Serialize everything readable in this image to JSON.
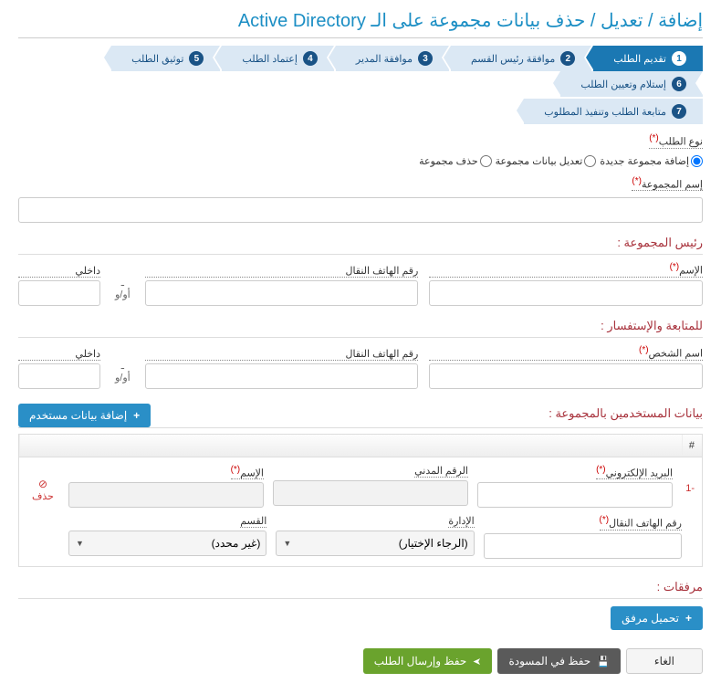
{
  "title": "إضافة / تعديل / حذف بيانات مجموعة على الـ Active Directory",
  "steps": [
    {
      "n": "1",
      "label": "تقديم الطلب",
      "active": true
    },
    {
      "n": "2",
      "label": "موافقة رئيس القسم"
    },
    {
      "n": "3",
      "label": "موافقة المدير"
    },
    {
      "n": "4",
      "label": "إعتماد الطلب"
    },
    {
      "n": "5",
      "label": "توثيق الطلب"
    },
    {
      "n": "6",
      "label": "إستلام وتعيين الطلب"
    }
  ],
  "step7": {
    "n": "7",
    "label": "متابعة الطلب وتنفيذ المطلوب"
  },
  "reqType": {
    "label": "نوع الطلب",
    "opts": [
      "إضافة مجموعة جديدة",
      "تعديل بيانات مجموعة",
      "حذف مجموعة"
    ]
  },
  "groupName": {
    "label": "إسم المجموعة"
  },
  "head": {
    "title": "رئيس المجموعة :",
    "name": "الإسم",
    "mobile": "رقم الهاتف النقال",
    "sep1": "ـ",
    "sep2": "أو/و",
    "ext": "داخلي"
  },
  "follow": {
    "title": "للمتابعة والإستفسار :",
    "name": "اسم الشخص",
    "mobile": "رقم الهاتف النقال",
    "sep1": "ـ",
    "sep2": "أو/و",
    "ext": "داخلي"
  },
  "users": {
    "title": "بيانات المستخدمين بالمجموعة :",
    "add": "إضافة بيانات مستخدم",
    "idx": "#",
    "row": "-1",
    "del": "حذف",
    "email": "البريد الإلكتروني",
    "civil": "الرقم المدني",
    "name": "الإسم",
    "mobile": "رقم الهاتف النقال",
    "dept": "الإدارة",
    "section": "القسم",
    "deptPlaceholder": "(الرجاء الإختيار)",
    "sectionPlaceholder": "(غير محدد)"
  },
  "attach": {
    "title": "مرفقات :",
    "upload": "تحميل مرفق"
  },
  "actions": {
    "send": "حفظ وإرسال الطلب",
    "draft": "حفظ في المسودة",
    "cancel": "الغاء"
  }
}
